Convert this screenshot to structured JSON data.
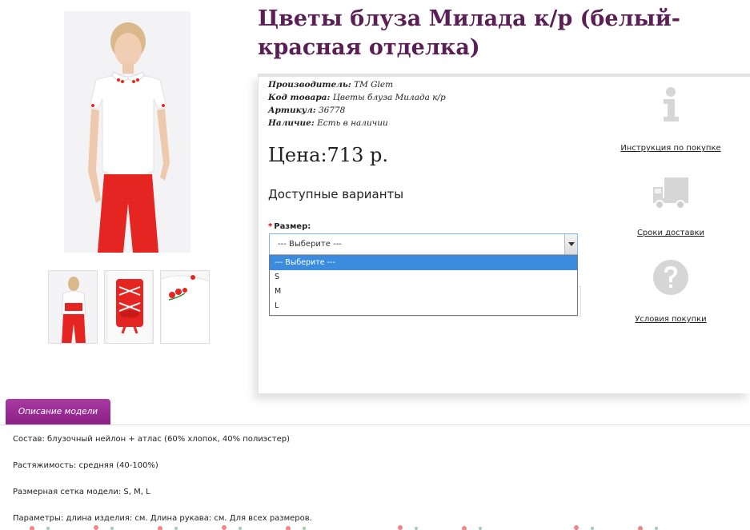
{
  "product": {
    "title": "Цветы блуза Милада к/р (белый-красная отделка)",
    "meta": [
      {
        "label": "Производитель:",
        "value": "TM Glem"
      },
      {
        "label": "Код товара:",
        "value": "Цветы блуза Милада к/р"
      },
      {
        "label": "Артикул:",
        "value": "36778"
      },
      {
        "label": "Наличие:",
        "value": "Есть в наличии"
      }
    ],
    "price": "Цена:713 р.",
    "variants_title": "Доступные варианты",
    "size": {
      "required_mark": "*",
      "label": "Размер:",
      "selected": "--- Выберите ---",
      "options": [
        "--- Выберите ---",
        "S",
        "M",
        "L"
      ]
    }
  },
  "side_links": [
    {
      "icon": "info-icon",
      "label": "Инструкция по покупке"
    },
    {
      "icon": "truck-icon",
      "label": "Сроки доставки"
    },
    {
      "icon": "question-icon",
      "label": "Условия покупки"
    }
  ],
  "tabs": {
    "description_label": "Описание модели"
  },
  "description": [
    {
      "key": "Состав:",
      "value": " блузочный нейлон + атлас (60% хлопок, 40% полиэстер)"
    },
    {
      "key": "Растяжимость:",
      "value": " средняя (40-100%)"
    },
    {
      "key": "Размерная сетка модели:",
      "value": " S, M, L"
    },
    {
      "key": "Параметры:",
      "value": " длина изделия: см. Длина рукава: см. Для всех размеров."
    }
  ],
  "colors": {
    "title": "#5a1f55",
    "tab": "#9a2c94",
    "dropdown_highlight": "#3b8cdf",
    "accent_red": "#e52521"
  }
}
